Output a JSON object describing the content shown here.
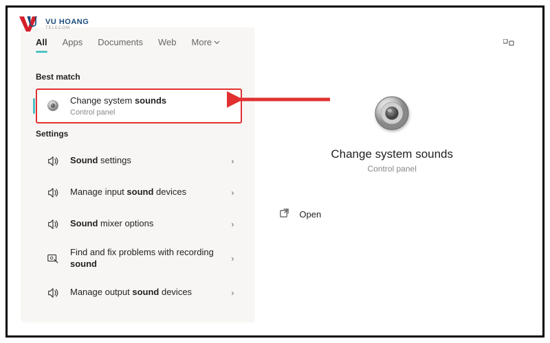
{
  "logo": {
    "name": "VU HOANG",
    "sub": "TELECOM"
  },
  "tabs": {
    "all": "All",
    "apps": "Apps",
    "documents": "Documents",
    "web": "Web",
    "more": "More"
  },
  "sections": {
    "best_match": "Best match",
    "settings": "Settings"
  },
  "best_match": {
    "title_pre": "Change system ",
    "title_bold": "sounds",
    "sub": "Control panel"
  },
  "settings_items": [
    {
      "pre": "",
      "bold": "Sound",
      "post": " settings"
    },
    {
      "pre": "Manage input ",
      "bold": "sound",
      "post": " devices"
    },
    {
      "pre": "",
      "bold": "Sound",
      "post": " mixer options"
    },
    {
      "pre": "Find and fix problems with recording ",
      "bold": "sound",
      "post": ""
    },
    {
      "pre": "Manage output ",
      "bold": "sound",
      "post": " devices"
    }
  ],
  "detail": {
    "title": "Change system sounds",
    "sub": "Control panel",
    "open": "Open"
  }
}
